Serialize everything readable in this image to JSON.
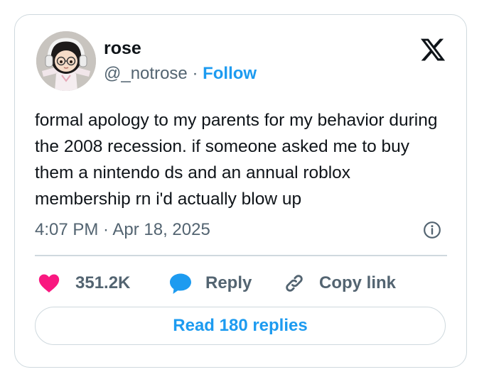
{
  "author": {
    "name": "rose",
    "handle": "@_notrose",
    "separator": "·",
    "follow_label": "Follow",
    "avatar_icon": "cartoon-girl-with-headphones-avatar"
  },
  "logo": {
    "icon": "x-logo-icon"
  },
  "tweet": {
    "text": "formal apology to my parents for my behavior during the 2008 recession. if someone asked me to buy them a nintendo ds and an annual roblox membership rn i'd actually blow up",
    "timestamp": "4:07 PM · Apr 18, 2025",
    "info_icon": "info-circle-icon"
  },
  "actions": {
    "like": {
      "icon": "heart-icon",
      "count": "351.2K",
      "color": "#f91880"
    },
    "reply": {
      "icon": "speech-bubble-icon",
      "label": "Reply",
      "color": "#1d9bf0"
    },
    "copy_link": {
      "icon": "link-icon",
      "label": "Copy link"
    }
  },
  "read_replies": {
    "label": "Read 180 replies"
  },
  "colors": {
    "accent": "#1d9bf0",
    "like": "#f91880",
    "text": "#0f1419",
    "secondary_text": "#536471",
    "border": "#cfd9de"
  }
}
